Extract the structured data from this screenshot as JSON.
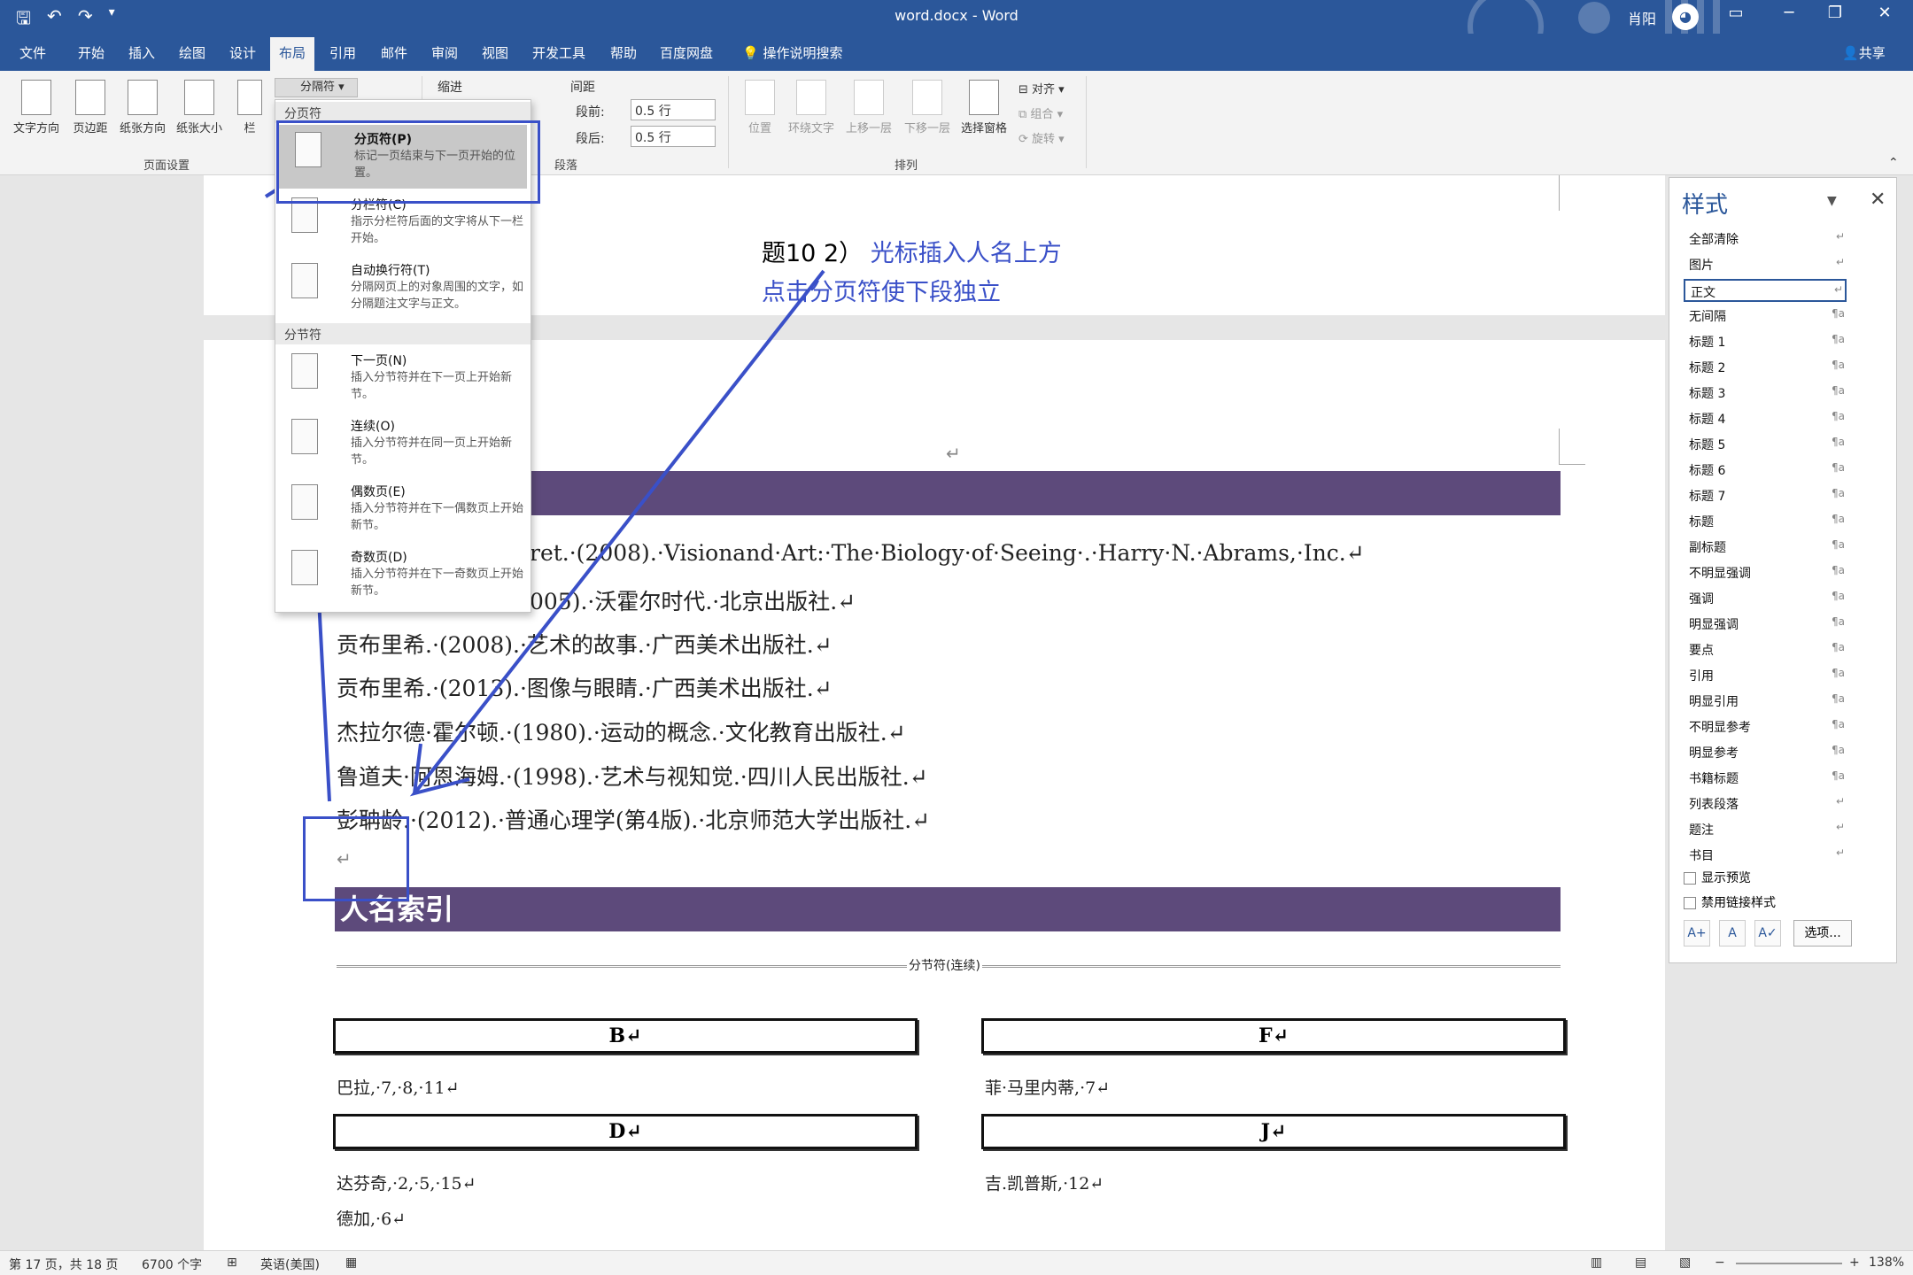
{
  "titlebar": {
    "title": "word.docx - Word",
    "user": "肖阳",
    "save_icon": "save-icon",
    "undo_icon": "undo-icon",
    "redo_icon": "redo-icon"
  },
  "tabs": [
    "文件",
    "开始",
    "插入",
    "绘图",
    "设计",
    "布局",
    "引用",
    "邮件",
    "审阅",
    "视图",
    "开发工具",
    "帮助",
    "百度网盘"
  ],
  "active_tab": "布局",
  "tellme": "操作说明搜索",
  "share": "共享",
  "ribbon": {
    "buttons": [
      "文字方向",
      "页边距",
      "纸张方向",
      "纸张大小",
      "栏"
    ],
    "page_setup_label": "页面设置",
    "breaks": "分隔符",
    "indent": "缩进",
    "spacing": "间距",
    "before_label": "段前:",
    "before_value": "0.5 行",
    "after_label": "段后:",
    "after_value": "0.5 行",
    "paragraph_label": "段落",
    "arrange_buttons": [
      "位置",
      "环绕文字",
      "上移一层",
      "下移一层",
      "选择窗格"
    ],
    "align": "对齐",
    "group": "组合",
    "rotate": "旋转",
    "arrange_label": "排列"
  },
  "dropdown": {
    "header1": "分页符",
    "items1": [
      {
        "title": "分页符(P)",
        "desc": "标记一页结束与下一页开始的位置。"
      },
      {
        "title": "分栏符(C)",
        "desc": "指示分栏符后面的文字将从下一栏开始。"
      },
      {
        "title": "自动换行符(T)",
        "desc": "分隔网页上的对象周围的文字，如分隔题注文字与正文。"
      }
    ],
    "header2": "分节符",
    "items2": [
      {
        "title": "下一页(N)",
        "desc": "插入分节符并在下一页上开始新节。"
      },
      {
        "title": "连续(O)",
        "desc": "插入分节符并在同一页上开始新节。"
      },
      {
        "title": "偶数页(E)",
        "desc": "插入分节符并在下一偶数页上开始新节。"
      },
      {
        "title": "奇数页(D)",
        "desc": "插入分节符并在下一奇数页上开始新节。"
      }
    ]
  },
  "annotation": {
    "prefix": "题10 2）",
    "line1": "光标插入人名上方",
    "line2": "点击分页符使下段独立"
  },
  "document": {
    "refs": [
      "ret.·(2008).·Visionand·Art:·The·Biology·of·Seeing·.·Harry·N.·Abrams,·Inc.↵",
      "005).·沃霍尔时代.·北京出版社.↵",
      "贡布里希.·(2008).·艺术的故事.·广西美术出版社.↵",
      "贡布里希.·(2013).·图像与眼睛.·广西美术出版社.↵",
      "杰拉尔德·霍尔顿.·(1980).·运动的概念.·文化教育出版社.↵",
      "鲁道夫·阿恩海姆.·(1998).·艺术与视知觉.·四川人民出版社.↵",
      "彭聃龄.·(2012).·普通心理学(第4版).·北京师范大学出版社.↵"
    ],
    "para_mark": "↵",
    "heading": "人名索引",
    "section_break": "分节符(连续)",
    "index": [
      {
        "letter": "B↵",
        "entries": [
          "巴拉,·7,·8,·11↵"
        ]
      },
      {
        "letter": "F↵",
        "entries": [
          "菲·马里内蒂,·7↵"
        ]
      },
      {
        "letter": "D↵",
        "entries": [
          "达芬奇,·2,·5,·15↵",
          "德加,·6↵"
        ]
      },
      {
        "letter": "J↵",
        "entries": [
          "吉.凯普斯,·12↵"
        ]
      }
    ]
  },
  "styles_pane": {
    "title": "样式",
    "items": [
      "全部清除",
      "图片",
      "正文",
      "无间隔",
      "标题 1",
      "标题 2",
      "标题 3",
      "标题 4",
      "标题 5",
      "标题 6",
      "标题 7",
      "标题",
      "副标题",
      "不明显强调",
      "强调",
      "明显强调",
      "要点",
      "引用",
      "明显引用",
      "不明显参考",
      "明显参考",
      "书籍标题",
      "列表段落",
      "题注",
      "书目"
    ],
    "selected": "正文",
    "show_preview": "显示预览",
    "disable_linked": "禁用链接样式",
    "options": "选项..."
  },
  "statusbar": {
    "page": "第 17 页，共 18 页",
    "words": "6700 个字",
    "lang": "英语(美国)",
    "zoom": "138%"
  },
  "colors": {
    "accent": "#2b579a",
    "heading_bar": "#5d4a7b",
    "annotation": "#3a50c8"
  }
}
